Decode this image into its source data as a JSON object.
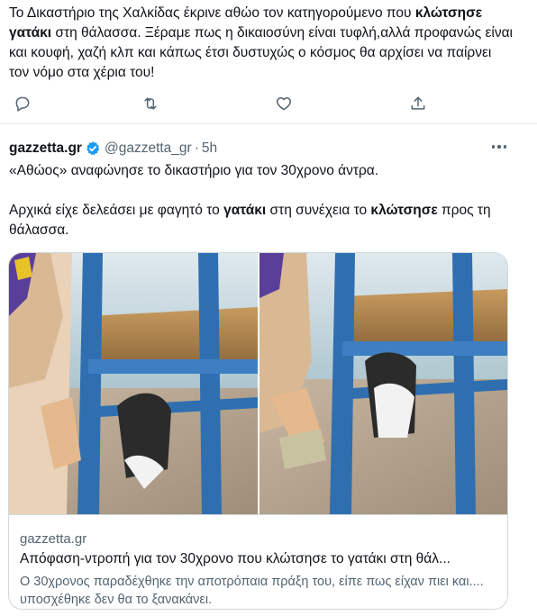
{
  "tweet1": {
    "text_part1": "Το Δικαστήριο της Χαλκίδας έκρινε αθώο τον κατηγορούμενο που ",
    "text_bold": "κλώτσησε γατάκι",
    "text_part2": " στη θάλασσα. Ξέραμε πως η δικαιοσύνη είναι τυφλή,αλλά προφανώς είναι και κουφή, χαζή κλπ και κάπως έτσι δυστυχώς ο κόσμος θα αρχίσει να παίρνει τον νόμο στα χέρια του!",
    "actions": [
      {
        "name": "reply",
        "icon": "reply-icon"
      },
      {
        "name": "retweet",
        "icon": "retweet-icon"
      },
      {
        "name": "like",
        "icon": "heart-icon"
      },
      {
        "name": "share",
        "icon": "share-icon"
      }
    ]
  },
  "tweet2": {
    "author_name": "gazzetta.gr",
    "handle": "@gazzetta_gr",
    "separator": "·",
    "time": "5h",
    "verified_icon": "verified-badge-icon",
    "more_icon": "more-options-icon",
    "line1": "«Αθώος» αναφώνησε το δικαστήριο για τον 30χρονο άντρα.",
    "line2_part1": "Αρχικά είχε δελεάσει με φαγητό το ",
    "line2_bold1": "γατάκι",
    "line2_part2": " στη συνέχεια το ",
    "line2_bold2": "κλώτσησε",
    "line2_part3": " προς τη θάλασσα.",
    "card": {
      "domain": "gazzetta.gr",
      "title": "Απόφαση-ντροπή για τον 30χρονο που κλώτσησε το γατάκι στη θάλ...",
      "description": "Ο 30χρονος παραδέχθηκε την αποτρόπαια πράξη του, είπε πως είχαν πιει και.... υποσχέθηκε δεν θα το ξανακάνει."
    }
  },
  "colors": {
    "text_primary": "#0f1419",
    "text_secondary": "#536471",
    "verified_blue": "#1d9bf0",
    "border": "#cfd9de",
    "chair_blue": "#2f6fb0"
  }
}
